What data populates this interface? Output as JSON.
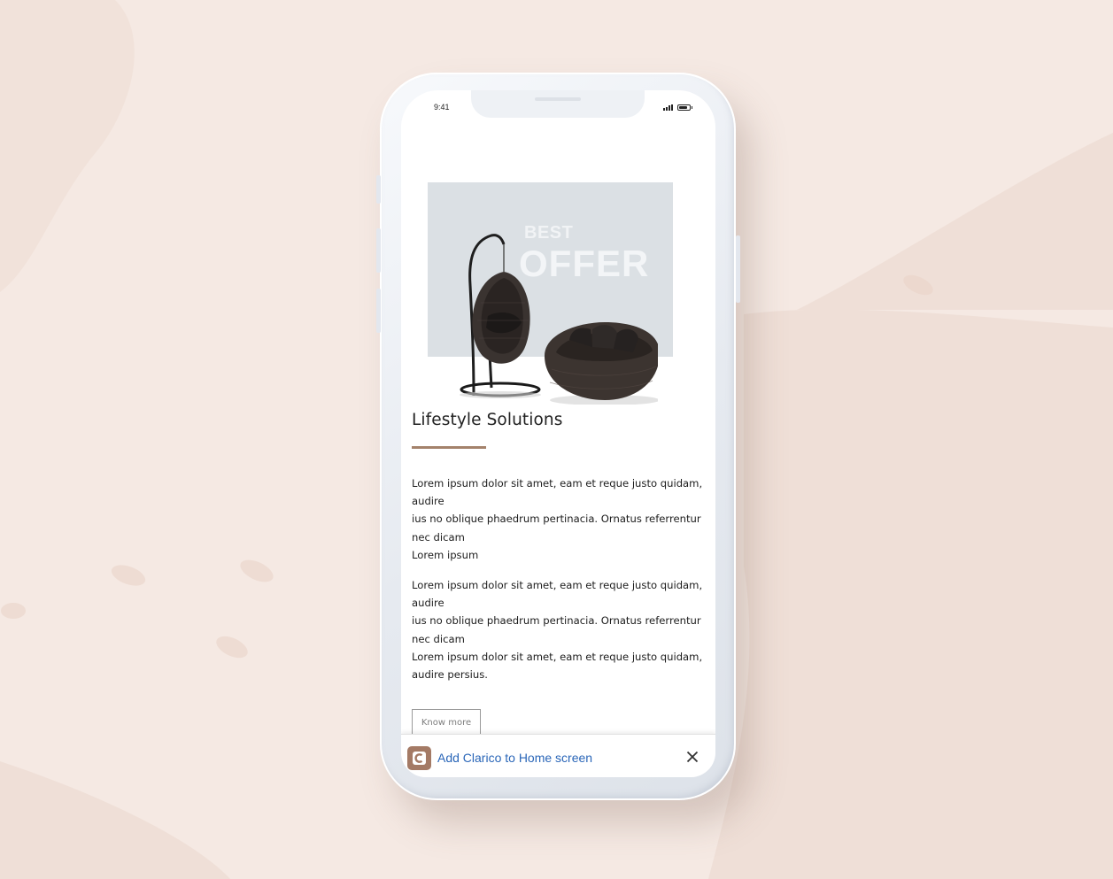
{
  "status_bar": {
    "time": "9:41"
  },
  "hero": {
    "line1": "BEST",
    "line2": "OFFER"
  },
  "section": {
    "title": "Lifestyle Solutions",
    "paragraph1": [
      "Lorem ipsum dolor sit amet, eam et reque justo quidam,",
      "audire",
      "ius no oblique phaedrum pertinacia. Ornatus referrentur",
      "nec dicam",
      "Lorem ipsum"
    ],
    "paragraph2": [
      "Lorem ipsum dolor sit amet, eam et reque justo quidam,",
      "audire",
      "ius no oblique phaedrum pertinacia. Ornatus referrentur",
      "nec dicam",
      "Lorem ipsum dolor sit amet, eam et reque justo quidam,",
      "audire persius."
    ],
    "button_label": "Know more"
  },
  "add_to_home": {
    "text": "Add Clarico to Home screen",
    "logo_icon": "clarico-logo-icon",
    "close_icon": "close-icon"
  },
  "colors": {
    "background": "#f5e9e3",
    "accent_rule": "#a4826b",
    "link_blue": "#2a66b8",
    "logo_brown": "#a47a65"
  }
}
